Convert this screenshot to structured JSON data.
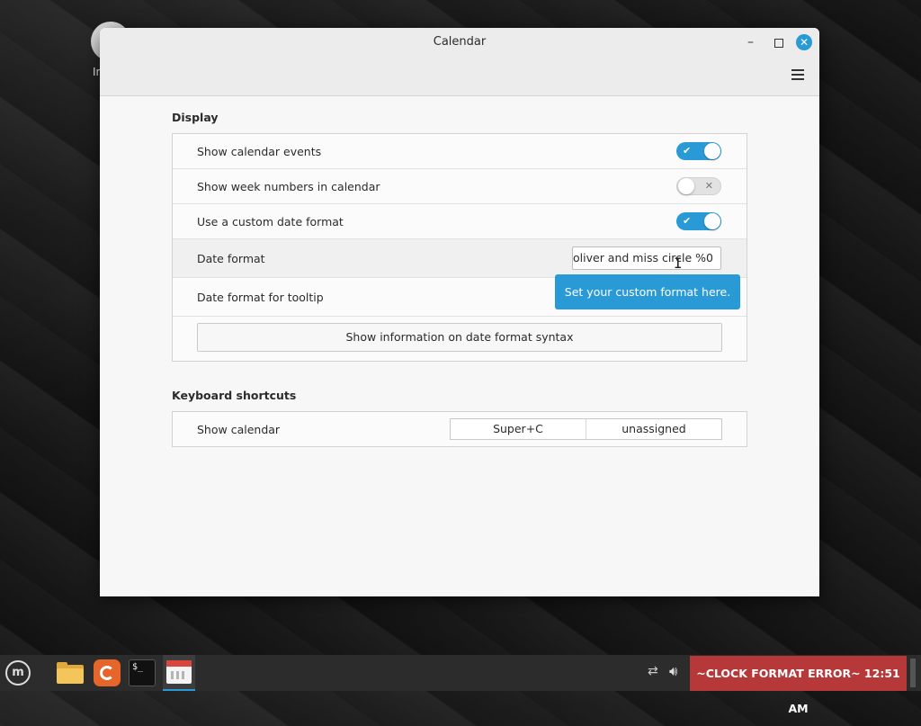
{
  "desktop": {
    "icon_label": "Ir"
  },
  "window": {
    "title": "Calendar",
    "close_glyph": "✕",
    "minimize_glyph": "–"
  },
  "display": {
    "section_title": "Display",
    "rows": [
      {
        "label": "Show calendar events",
        "type": "toggle",
        "on": true
      },
      {
        "label": "Show week numbers in calendar",
        "type": "toggle",
        "on": false
      },
      {
        "label": "Use a custom date format",
        "type": "toggle",
        "on": true
      },
      {
        "label": "Date format",
        "type": "entry",
        "value": "oliver and miss circle %0"
      },
      {
        "label": "Date format for tooltip",
        "type": "entry"
      }
    ],
    "tooltip": "Set your custom format here.",
    "info_button": "Show information on date format syntax"
  },
  "shortcuts": {
    "section_title": "Keyboard shortcuts",
    "row_label": "Show calendar",
    "primary": "Super+C",
    "secondary": "unassigned"
  },
  "taskbar": {
    "apps": [
      "menu-icon",
      "files-icon",
      "firefox-icon",
      "terminal-icon",
      "calendar-icon"
    ],
    "terminal_prompt": "$_",
    "clock": "~CLOCK FORMAT ERROR~ 12:51 AM",
    "colors": {
      "clock_bg": "#b63838",
      "accent": "#2a9ad6"
    }
  }
}
